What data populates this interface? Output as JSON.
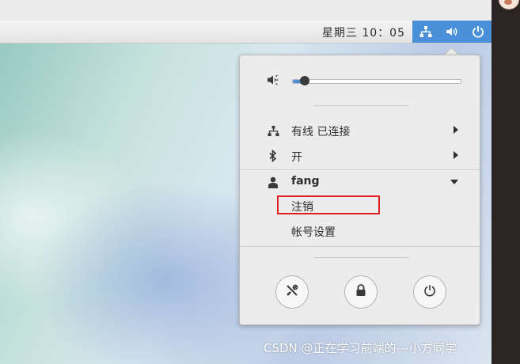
{
  "panel": {
    "clock": "星期三 10：05",
    "indicators": [
      "network-icon",
      "volume-icon",
      "power-icon"
    ]
  },
  "menu": {
    "volume": {
      "level": 0.07
    },
    "network": {
      "label": "有线 已连接"
    },
    "bluetooth": {
      "label": "开"
    },
    "user": {
      "name": "fang",
      "logout": "注销",
      "account_settings": "帐号设置"
    },
    "actions": [
      "settings-icon",
      "lock-icon",
      "power-icon"
    ]
  },
  "colors": {
    "accent": "#4a90d9",
    "highlight_box": "#e02020"
  },
  "watermark": "CSDN @正在学习前端的---小方同学"
}
